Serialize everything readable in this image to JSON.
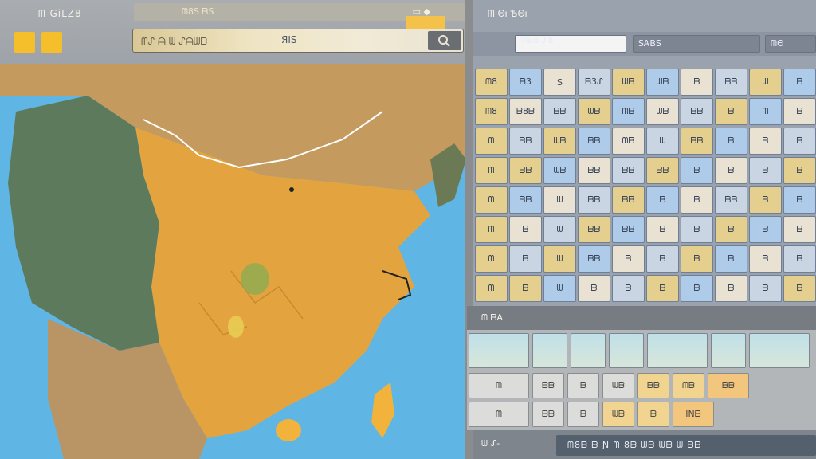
{
  "app": {
    "title": "ᗰ GiLZ8",
    "square_icons": [
      "yellow-square-icon",
      "yellow-square-icon"
    ]
  },
  "toolbar": {
    "strip_label": "ᗰ8Ѕ ᗷЅ",
    "strip_icon": "▭ ◆"
  },
  "search": {
    "value": "ᗰᔑ ᗩ ᗯ ᔑᗩᗯᗷ",
    "tag": "ЯIЅ",
    "button_icon": "search-icon"
  },
  "map": {
    "colors": {
      "sea": "#5fb5e4",
      "land_west": "#5e7a5c",
      "land_east": "#e3a43f",
      "north": "#c49a5e",
      "island": "#f2b33d"
    }
  },
  "panel": {
    "title": "ᗰ ΘᎥ ѢΘᎥ",
    "tab_label": "ᗰᏴ8 ᔑ8",
    "tabs": [
      "",
      "ЅᎪBЅ",
      "ᗰΘ"
    ]
  },
  "grid": {
    "rows": [
      [
        "ᗰ8",
        "ᗷ3",
        "Ѕ",
        "ᗷ3ᔑ",
        "ᗯᗷ",
        "ᗯᗷ",
        "ᗷ",
        "ᗷᗷ",
        "ᗯ",
        "ᗷ"
      ],
      [
        "ᗰ8",
        "ᗷ8ᗷ",
        "ᗷᗷ",
        "ᗯᗷ",
        "ᗰᗷ",
        "ᗯᗷ",
        "ᗷᗷ",
        "ᗷ",
        "ᗰ",
        "ᗷ"
      ],
      [
        "ᗰ",
        "ᗷᗷ",
        "ᗯᗷ",
        "ᗷᗷ",
        "ᗰᗷ",
        "ᗯ",
        "ᗷᗷ",
        "ᗷ",
        "ᗷ",
        "ᗷ"
      ],
      [
        "ᗰ",
        "ᗷᗷ",
        "ᗯᗷ",
        "ᗷᗷ",
        "ᗷᗷ",
        "ᗷᗷ",
        "ᗷ",
        "ᗷ",
        "ᗷ",
        "ᗷ"
      ],
      [
        "ᗰ",
        "ᗷᗷ",
        "ᗯ",
        "ᗷᗷ",
        "ᗷᗷ",
        "ᗷ",
        "ᗷ",
        "ᗷᗷ",
        "ᗷ",
        "ᗷ"
      ],
      [
        "ᗰ",
        "ᗷ",
        "ᗯ",
        "ᗷᗷ",
        "ᗷᗷ",
        "ᗷ",
        "ᗷ",
        "ᗷ",
        "ᗷ",
        "ᗷ"
      ],
      [
        "ᗰ",
        "ᗷ",
        "ᗯ",
        "ᗷᗷ",
        "ᗷ",
        "ᗷ",
        "ᗷ",
        "ᗷ",
        "ᗷ",
        "ᗷ"
      ],
      [
        "ᗰ",
        "ᗷ",
        "ᗯ",
        "ᗷ",
        "ᗷ",
        "ᗷ",
        "ᗷ",
        "ᗷ",
        "ᗷ",
        "ᗷ"
      ]
    ]
  },
  "lower": {
    "title": "ᗰ ᗷA",
    "row1": [
      "ᗰ",
      "ᗷᗷ",
      "ᗷ",
      "ᗯᗷ",
      "ᗷᗷ",
      "ᗰᗷ",
      "ᗷᗷ"
    ],
    "row2": [
      "ᗰ",
      "ᗷᗷ",
      "ᗷ",
      "ᗯᗷ",
      "ᗷ",
      "INᗷ"
    ]
  },
  "bottom": {
    "label": "ᗯ ᔑ-",
    "status": "ᗰ8ᗷ ᗷ Ɲ ᗰ 8ᗷ ᗯᗷ ᗯᗷ ᗯ ᗷᗷ"
  }
}
